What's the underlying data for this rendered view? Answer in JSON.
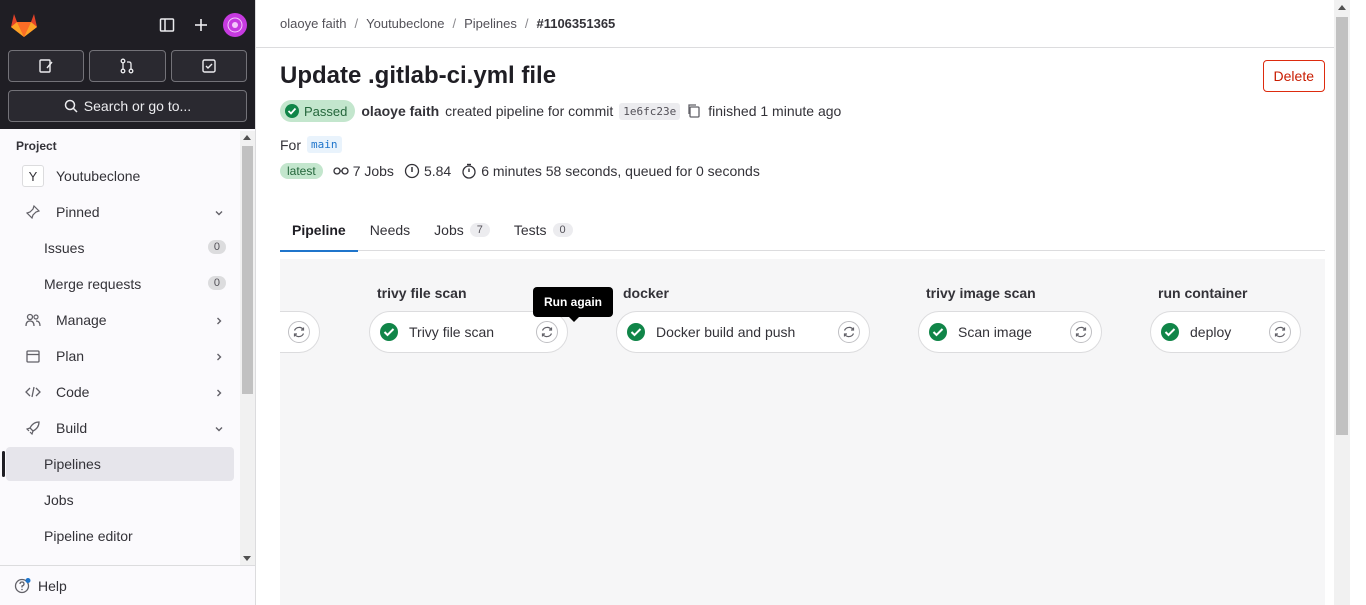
{
  "sidebar": {
    "section_title": "Project",
    "project": {
      "initial": "Y",
      "name": "Youtubeclone"
    },
    "search_label": "Search or go to...",
    "items": [
      {
        "label": "Pinned"
      },
      {
        "label": "Issues",
        "count": "0"
      },
      {
        "label": "Merge requests",
        "count": "0"
      },
      {
        "label": "Manage"
      },
      {
        "label": "Plan"
      },
      {
        "label": "Code"
      },
      {
        "label": "Build"
      },
      {
        "label": "Pipelines"
      },
      {
        "label": "Jobs"
      },
      {
        "label": "Pipeline editor"
      }
    ],
    "help_label": "Help"
  },
  "breadcrumb": [
    "olaoye faith",
    "Youtubeclone",
    "Pipelines",
    "#1106351365"
  ],
  "header": {
    "title": "Update .gitlab-ci.yml file",
    "delete_label": "Delete",
    "status": "Passed",
    "author": "olaoye faith",
    "created_text": "created pipeline for commit",
    "sha": "1e6fc23e",
    "finished_text": "finished 1 minute ago",
    "for_label": "For",
    "ref": "main",
    "latest_label": "latest",
    "jobs_text": "7 Jobs",
    "score": "5.84",
    "duration_text": "6 minutes 58 seconds, queued for 0 seconds"
  },
  "tabs": [
    {
      "label": "Pipeline"
    },
    {
      "label": "Needs"
    },
    {
      "label": "Jobs",
      "count": "7"
    },
    {
      "label": "Tests",
      "count": "0"
    }
  ],
  "pipeline": {
    "tooltip": "Run again",
    "stages": [
      {
        "title": "trivy file scan",
        "job": "Trivy file scan"
      },
      {
        "title": "docker",
        "job": "Docker build and push"
      },
      {
        "title": "trivy image scan",
        "job": "Scan image"
      },
      {
        "title": "run container",
        "job": "deploy"
      }
    ]
  },
  "colors": {
    "success": "#108548",
    "accent": "#1f75cb",
    "danger": "#dd2b0e"
  }
}
